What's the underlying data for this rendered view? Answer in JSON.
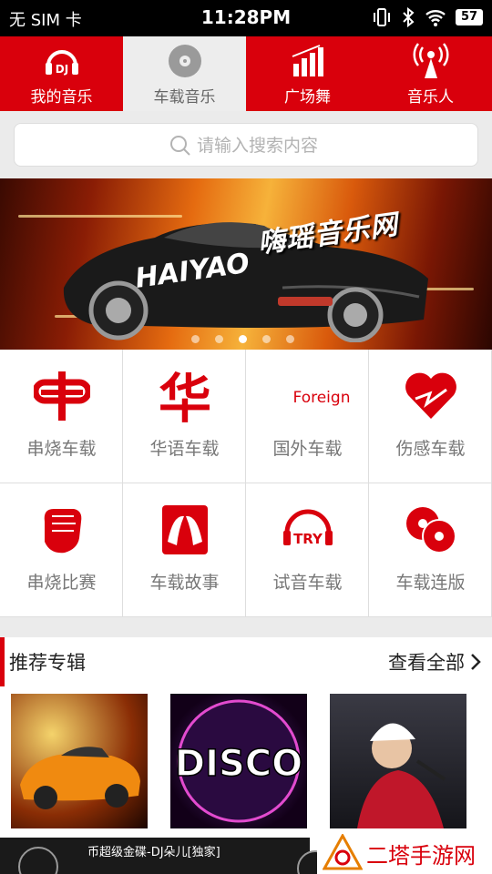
{
  "status_bar": {
    "carrier": "无 SIM 卡",
    "time": "11:28PM",
    "battery": "57",
    "icons": [
      "vibrate-icon",
      "bluetooth-icon",
      "wifi-icon",
      "battery-icon"
    ]
  },
  "tabs": [
    {
      "label": "我的音乐",
      "icon": "dj-headphones-icon",
      "active": false
    },
    {
      "label": "车载音乐",
      "icon": "disc-icon",
      "active": true
    },
    {
      "label": "广场舞",
      "icon": "bars-chart-icon",
      "active": false
    },
    {
      "label": "音乐人",
      "icon": "antenna-icon",
      "active": false
    }
  ],
  "search": {
    "placeholder": "请输入搜索内容"
  },
  "banner": {
    "title": "嗨瑶音乐网",
    "logo": "HAIYAO",
    "dots_count": 5,
    "active_dot": 2
  },
  "categories": [
    {
      "label": "串烧车载",
      "icon": "medley-icon"
    },
    {
      "label": "华语车载",
      "icon": "chinese-hua-icon"
    },
    {
      "label": "国外车载",
      "icon": "foreign-icon",
      "icon_text": "Foreign"
    },
    {
      "label": "伤感车载",
      "icon": "broken-heart-icon"
    },
    {
      "label": "串烧比赛",
      "icon": "fist-icon"
    },
    {
      "label": "车载故事",
      "icon": "faces-icon"
    },
    {
      "label": "试音车载",
      "icon": "try-headphones-icon",
      "icon_text": "TRY"
    },
    {
      "label": "车载连版",
      "icon": "discs-icon"
    }
  ],
  "section": {
    "title": "推荐专辑",
    "more": "查看全部"
  },
  "albums": [
    {
      "name": "album-car",
      "art_text": ""
    },
    {
      "name": "album-disco",
      "art_text": "DISCO"
    },
    {
      "name": "album-singer",
      "art_text": ""
    }
  ],
  "player": {
    "song": "币超级金碟-DJ朵儿[独家]"
  },
  "watermark": {
    "text": "二塔手游网"
  },
  "colors": {
    "accent": "#d9000c",
    "active_tab_bg": "#ededed"
  }
}
